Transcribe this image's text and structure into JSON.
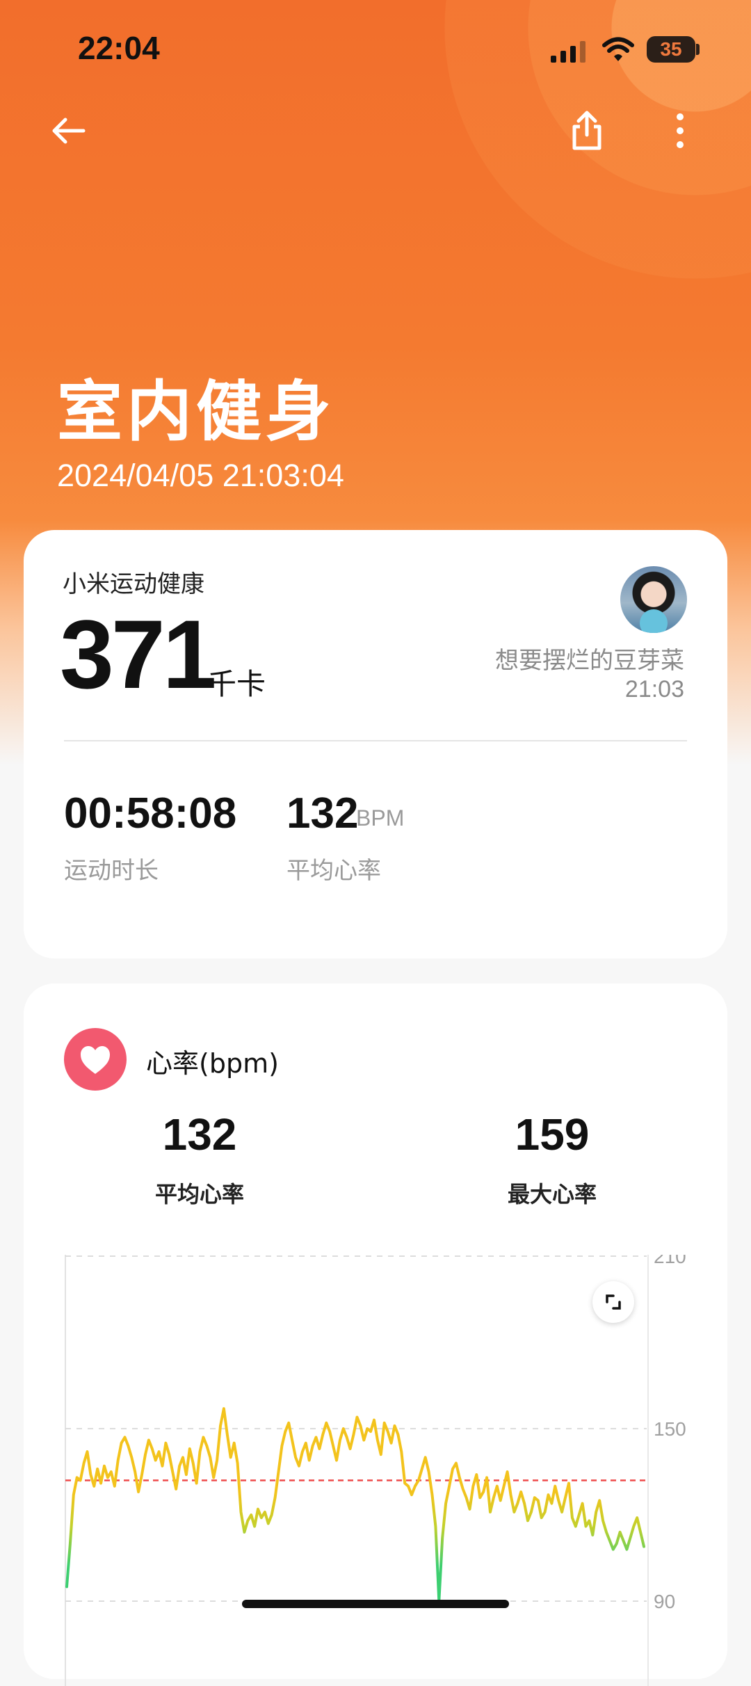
{
  "status_bar": {
    "time": "22:04",
    "battery": "35"
  },
  "header": {
    "title": "室内健身",
    "datetime": "2024/04/05 21:03:04"
  },
  "summary": {
    "source": "小米运动健康",
    "calories": "371",
    "calories_unit": "千卡",
    "username": "想要摆烂的豆芽菜",
    "user_time": "21:03",
    "duration": "00:58:08",
    "duration_label": "运动时长",
    "avg_hr": "132",
    "avg_hr_unit": "BPM",
    "avg_hr_label": "平均心率"
  },
  "heart_rate": {
    "title": "心率(bpm)",
    "avg_value": "132",
    "avg_label": "平均心率",
    "max_value": "159",
    "max_label": "最大心率"
  },
  "chart_data": {
    "type": "line",
    "ylabel": "",
    "xlabel": "",
    "ylim": [
      60,
      210
    ],
    "yticks": [
      210,
      150,
      90
    ],
    "average_line": 132,
    "grid": true,
    "series": [
      {
        "values": [
          95,
          110,
          127,
          133,
          132,
          138,
          142,
          134,
          130,
          136,
          131,
          137,
          133,
          135,
          130,
          139,
          145,
          147,
          144,
          140,
          135,
          128,
          134,
          141,
          146,
          143,
          139,
          142,
          137,
          145,
          141,
          135,
          129,
          137,
          140,
          134,
          143,
          138,
          131,
          142,
          147,
          144,
          140,
          133,
          139,
          151,
          157,
          148,
          140,
          145,
          138,
          121,
          114,
          118,
          120,
          116,
          122,
          119,
          121,
          117,
          120,
          126,
          135,
          144,
          149,
          152,
          146,
          140,
          137,
          142,
          145,
          139,
          144,
          147,
          143,
          148,
          152,
          149,
          144,
          139,
          146,
          150,
          147,
          143,
          148,
          154,
          151,
          146,
          150,
          149,
          153,
          146,
          141,
          152,
          149,
          145,
          151,
          148,
          142,
          131,
          130,
          127,
          130,
          132,
          136,
          140,
          135,
          127,
          116,
          90,
          112,
          124,
          130,
          136,
          138,
          133,
          129,
          126,
          122,
          130,
          134,
          126,
          128,
          133,
          121,
          126,
          130,
          125,
          130,
          135,
          127,
          121,
          124,
          128,
          124,
          118,
          121,
          126,
          125,
          119,
          121,
          127,
          124,
          130,
          125,
          121,
          126,
          131,
          119,
          116,
          120,
          124,
          116,
          118,
          113,
          121,
          125,
          118,
          114,
          111,
          108,
          110,
          114,
          111,
          108,
          112,
          116,
          119,
          114,
          109
        ]
      }
    ]
  }
}
